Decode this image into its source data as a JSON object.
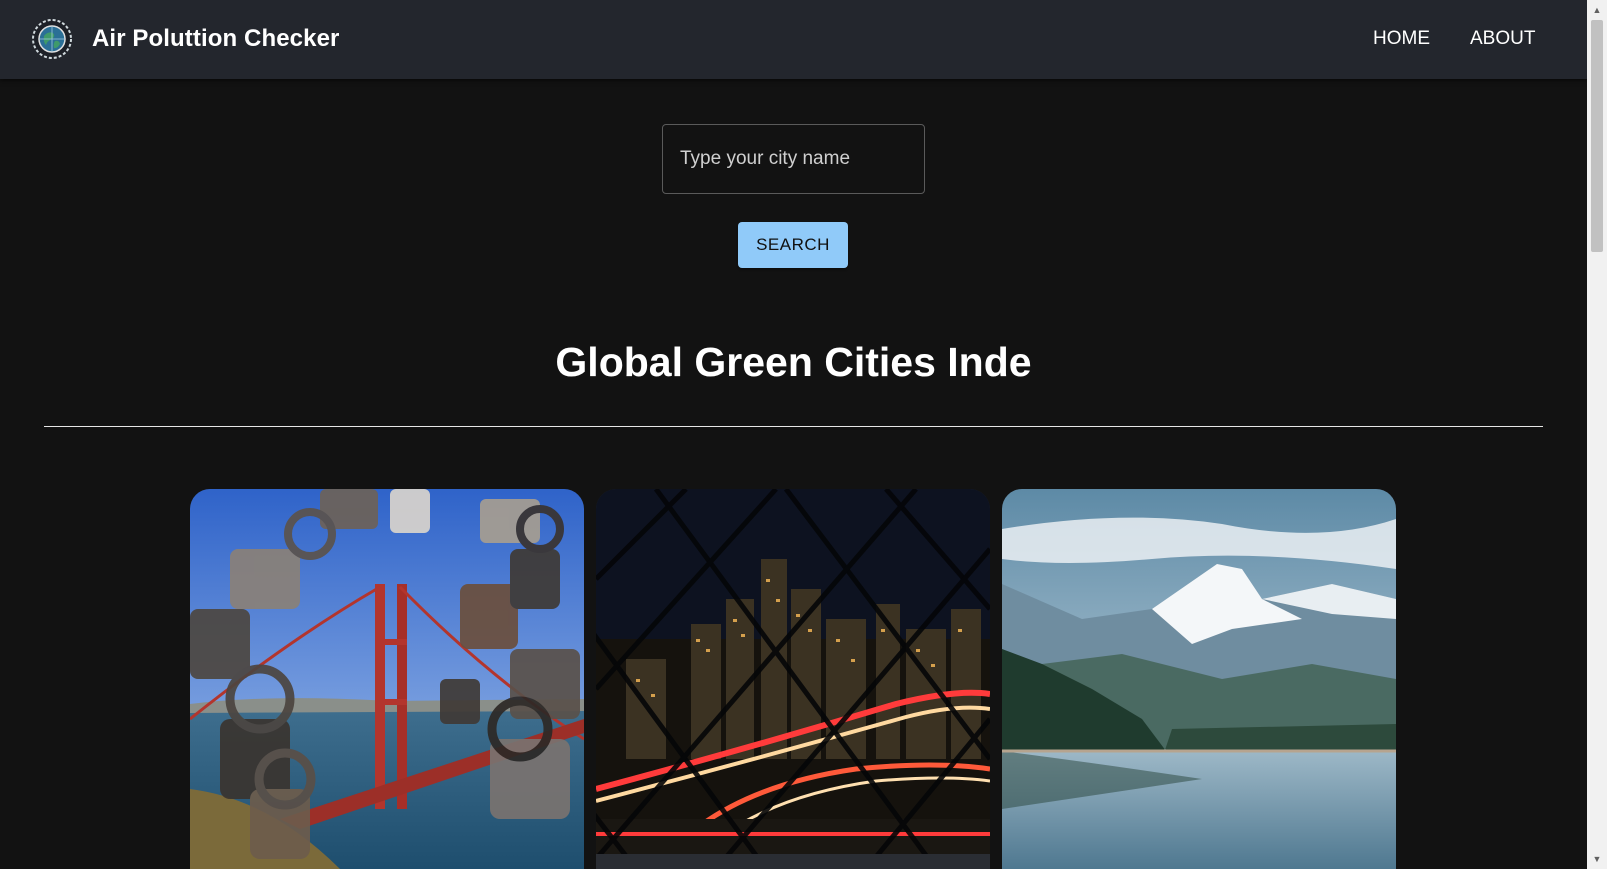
{
  "header": {
    "title": "Air Poluttion Checker",
    "nav": [
      {
        "label": "HOME"
      },
      {
        "label": "ABOUT"
      }
    ],
    "logo_icon": "globe-icon"
  },
  "search": {
    "placeholder": "Type your city name",
    "value": "",
    "button_label": "SEARCH"
  },
  "section": {
    "heading": "Global Green Cities Inde"
  },
  "cards": [
    {
      "image": "golden-gate-bridge-with-padlocks"
    },
    {
      "image": "night-city-skyline-through-fence"
    },
    {
      "image": "snowy-mountains-and-lake"
    }
  ],
  "colors": {
    "appbar": "#23262d",
    "background": "#121212",
    "button": "#90caf9"
  }
}
